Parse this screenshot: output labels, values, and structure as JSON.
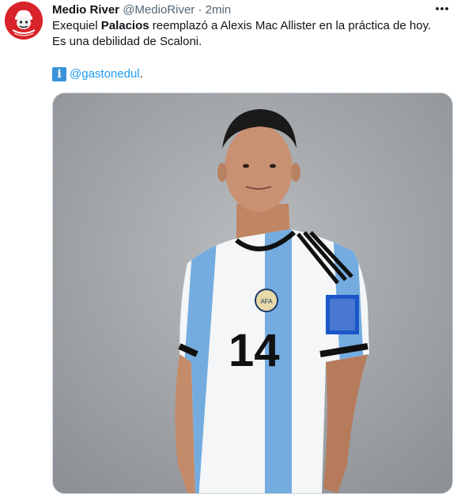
{
  "tweet": {
    "author_name": "Medio River",
    "handle": "@MedioRiver",
    "separator": "·",
    "time": "2min",
    "text_pre": "Exequiel ",
    "text_bold": "Palacios",
    "text_post": " reemplazó a Alexis Mac Allister en la práctica de hoy. Es una debilidad de Scaloni.",
    "credit_icon_glyph": "i",
    "credit_mention": "@gastonedul",
    "credit_suffix": "."
  },
  "icons": {
    "avatar": "medio-river-logo",
    "more": "more-horizontal-icon",
    "credit": "info-icon"
  },
  "colors": {
    "avatar_bg": "#d8232a",
    "link": "#1d9bf0",
    "muted": "#536471",
    "info_icon": "#3b94d9",
    "photo_bg": "#a5a8ac",
    "jersey_blue": "#74acdf"
  },
  "media": {
    "jersey_number": "14",
    "jersey_badge": "AFA"
  }
}
